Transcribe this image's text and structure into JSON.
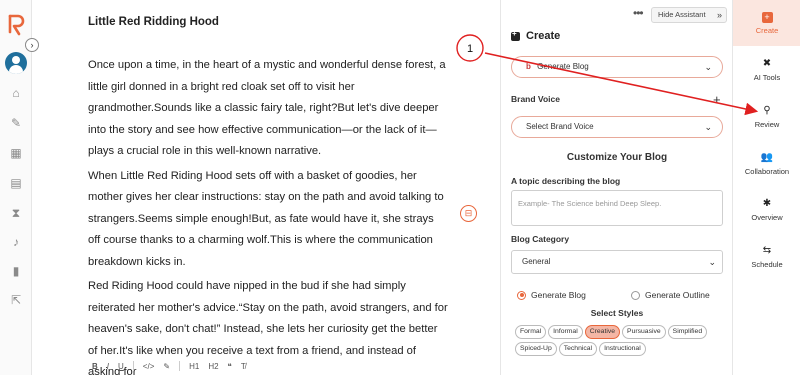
{
  "document": {
    "title": "Little Red Ridding Hood",
    "paragraphs": [
      "Once upon a time, in the heart of a mystic and wonderful dense forest, a little girl donned in a bright red cloak set off to visit her grandmother.Sounds like a classic fairy tale, right?But let's dive deeper into the story and see how effective communication—or the lack of it—plays a crucial role in this well-known narrative.",
      "When Little Red Riding Hood sets off with a basket of goodies, her mother gives her clear instructions: stay on the path and avoid talking to strangers.Seems simple enough!But, as fate would have it, she strays off course thanks to a charming wolf.This is where the communication breakdown kicks in.",
      "Red Riding Hood could have nipped in the bud if she had simply reiterated her mother's advice.“Stay on the path, avoid strangers, and for heaven's sake, don't chat!” Instead, she lets her curiosity get the better of her.It's like when you receive a text from a friend, and instead of asking for"
    ],
    "format_toolbar": [
      "B",
      "I",
      "U",
      "</>",
      "✎",
      "H1",
      "H2",
      "❝",
      "T̸"
    ]
  },
  "assistant": {
    "menu_dots": "•••",
    "hide_label": "Hide Assistant",
    "hide_chevron": "»",
    "create_title": "Create",
    "generate_select": "Generate Blog",
    "generate_icon": "b",
    "brand_voice_label": "Brand Voice",
    "brand_voice_add": "+",
    "brand_voice_select": "Select Brand Voice",
    "customize_title": "Customize Your Blog",
    "topic_label": "A topic describing the blog",
    "topic_placeholder": "Example- The Science behind Deep Sleep.",
    "category_label": "Blog Category",
    "category_value": "General",
    "radio_generate_blog": "Generate Blog",
    "radio_generate_outline": "Generate Outline",
    "radio_selected": "Generate Blog",
    "styles_title": "Select Styles",
    "styles": [
      {
        "label": "Formal",
        "active": false
      },
      {
        "label": "Informal",
        "active": false
      },
      {
        "label": "Creative",
        "active": true
      },
      {
        "label": "Pursuasive",
        "active": false
      },
      {
        "label": "Simplified",
        "active": false
      },
      {
        "label": "Spiced-Up",
        "active": false
      },
      {
        "label": "Technical",
        "active": false
      },
      {
        "label": "Instructional",
        "active": false
      }
    ]
  },
  "iconbar": {
    "items": [
      {
        "label": "Create",
        "icon": "plus-square-icon",
        "active": true
      },
      {
        "label": "AI Tools",
        "icon": "tools-icon",
        "active": false
      },
      {
        "label": "Review",
        "icon": "search-icon",
        "active": false
      },
      {
        "label": "Collaboration",
        "icon": "users-icon",
        "active": false
      },
      {
        "label": "Overview",
        "icon": "asterisk-icon",
        "active": false
      },
      {
        "label": "Schedule",
        "icon": "signpost-icon",
        "active": false
      }
    ]
  },
  "annotation": {
    "number": "1",
    "color": "#e02020"
  },
  "colors": {
    "accent": "#e8673c",
    "annotation": "#e02020",
    "avatar": "#1f6f9c"
  }
}
